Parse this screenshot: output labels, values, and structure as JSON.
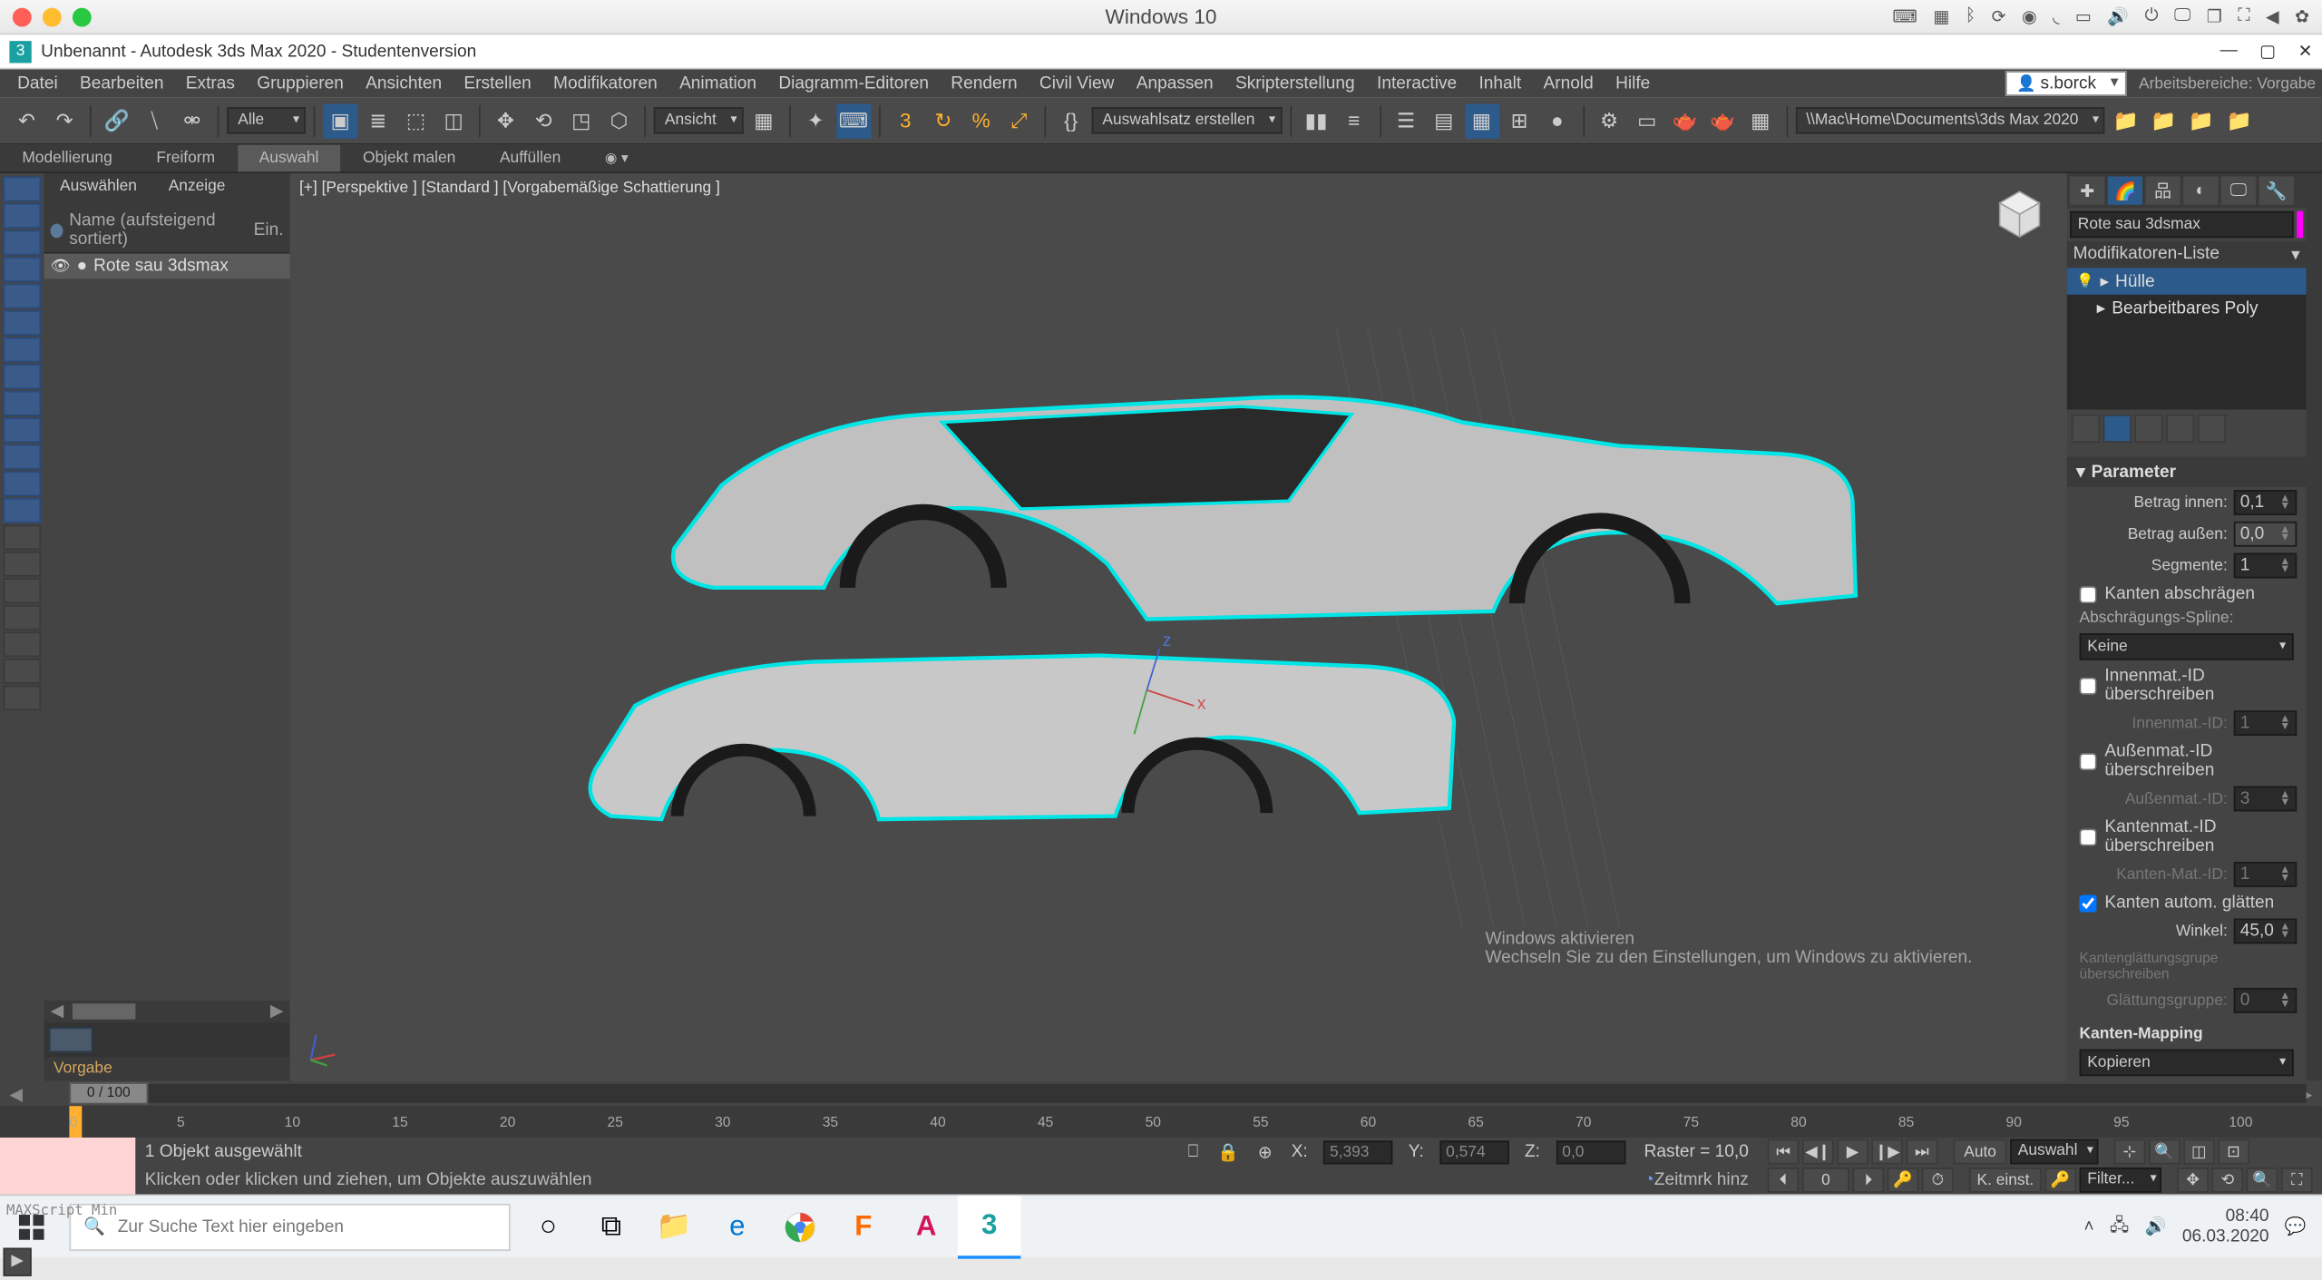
{
  "mac": {
    "title": "Windows 10"
  },
  "win": {
    "title": "Unbenannt - Autodesk 3ds Max 2020  - Studentenversion"
  },
  "menu": [
    "Datei",
    "Bearbeiten",
    "Extras",
    "Gruppieren",
    "Ansichten",
    "Erstellen",
    "Modifikatoren",
    "Animation",
    "Diagramm-Editoren",
    "Rendern",
    "Civil View",
    "Anpassen",
    "Skripterstellung",
    "Interactive",
    "Inhalt",
    "Arnold",
    "Hilfe"
  ],
  "user": "s.borck",
  "workspace_lbl": "Arbeitsbereiche:  Vorgabe",
  "tb": {
    "dd1": "Alle",
    "dd2": "Ansicht",
    "dd3": "Auswahlsatz erstellen",
    "path": "\\\\Mac\\Home\\Documents\\3ds Max 2020"
  },
  "ribbon": [
    "Modellierung",
    "Freiform",
    "Auswahl",
    "Objekt malen",
    "Auffüllen"
  ],
  "ribbon_active": 2,
  "explorer": {
    "tabs": [
      "Auswählen",
      "Anzeige"
    ],
    "header": "Name (aufsteigend sortiert)",
    "header2": "Ein.",
    "item": "Rote sau 3dsmax",
    "footer": "Vorgabe"
  },
  "viewport_label": "[+]  [Perspektive ]  [Standard ]  [Vorgabemäßige Schattierung ]",
  "cmd": {
    "name": "Rote sau 3dsmax",
    "modlist_h": "Modifikatoren-Liste",
    "mods": [
      {
        "label": "Hülle",
        "sel": true,
        "bulb": true
      },
      {
        "label": "Bearbeitbares Poly",
        "sel": false,
        "bulb": false
      }
    ],
    "rollout": "Parameter",
    "p_innen_lbl": "Betrag innen:",
    "p_innen": "0,1",
    "p_aussen_lbl": "Betrag außen:",
    "p_aussen": "0,0",
    "p_seg_lbl": "Segmente:",
    "p_seg": "1",
    "chk_bevel": "Kanten abschrägen",
    "spline_lbl": "Abschrägungs-Spline:",
    "spline_dd": "Keine",
    "chk_innen": "Innenmat.-ID überschreiben",
    "innen_id_lbl": "Innenmat.-ID:",
    "innen_id": "1",
    "chk_aussen": "Außenmat.-ID überschreiben",
    "aussen_id_lbl": "Außenmat.-ID:",
    "aussen_id": "3",
    "chk_kanten": "Kantenmat.-ID überschreiben",
    "kanten_id_lbl": "Kanten-Mat.-ID:",
    "kanten_id": "1",
    "chk_smooth": "Kanten autom. glätten",
    "winkel_lbl": "Winkel:",
    "winkel": "45,0",
    "sg_over": "Kantenglättungsgrupe überschreiben",
    "sg_lbl": "Glättungsgruppe:",
    "sg": "0",
    "map_lbl": "Kanten-Mapping",
    "map_dd": "Kopieren"
  },
  "time": {
    "label": "0 / 100",
    "ticks": [
      0,
      5,
      10,
      15,
      20,
      25,
      30,
      35,
      40,
      45,
      50,
      55,
      60,
      65,
      70,
      75,
      80,
      85,
      90,
      95,
      100
    ]
  },
  "status": {
    "sel": "1 Objekt ausgewählt",
    "hint": "Klicken oder klicken und ziehen, um Objekte auszuwählen",
    "x": "X:",
    "xv": "5,393",
    "y": "Y:",
    "yv": "0,574",
    "z": "Z:",
    "zv": "0,0",
    "raster": "Raster = 10,0",
    "zeitmrk": "Zeitmrk hinz",
    "auto": "Auto",
    "auswahl": "Auswahl",
    "keinst": "K. einst.",
    "filter": "Filter...",
    "script": "MAXScript Min"
  },
  "watermark": {
    "l1": "Windows aktivieren",
    "l2": "Wechseln Sie zu den Einstellungen, um Windows zu aktivieren."
  },
  "taskbar": {
    "search": "Zur Suche Text hier eingeben",
    "time": "08:40",
    "date": "06.03.2020"
  }
}
